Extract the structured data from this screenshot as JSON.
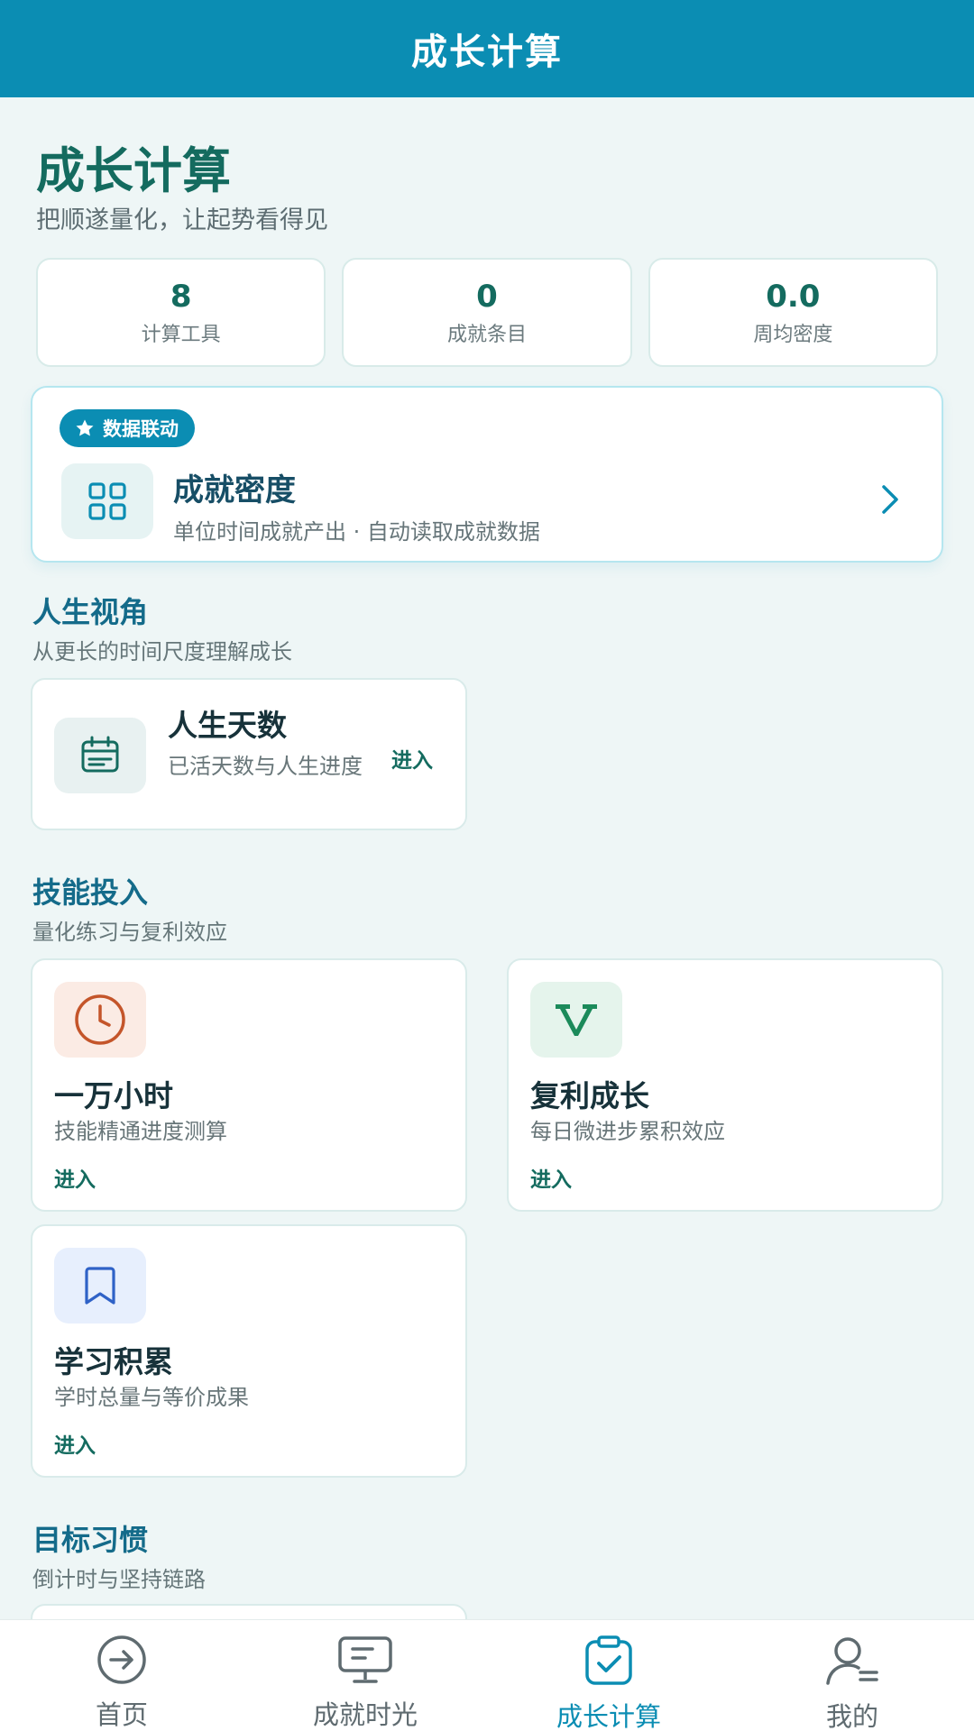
{
  "header": {
    "title": "成长计算"
  },
  "intro": {
    "title": "成长计算",
    "subtitle": "把顺遂量化，让起势看得见"
  },
  "stats": [
    {
      "value": "8",
      "label": "计算工具"
    },
    {
      "value": "0",
      "label": "成就条目"
    },
    {
      "value": "0.0",
      "label": "周均密度"
    }
  ],
  "featured": {
    "badge": "数据联动",
    "title": "成就密度",
    "description": "单位时间成就产出 · 自动读取成就数据",
    "icon": "grid-icon"
  },
  "sections": [
    {
      "title": "人生视角",
      "subtitle": "从更长的时间尺度理解成长",
      "cards": [
        {
          "title": "人生天数",
          "description": "已活天数与人生进度",
          "enter": "进入",
          "icon": "calendar-icon"
        }
      ]
    },
    {
      "title": "技能投入",
      "subtitle": "量化练习与复利效应",
      "cards": [
        {
          "title": "一万小时",
          "description": "技能精通进度测算",
          "enter": "进入",
          "icon": "clock-icon"
        },
        {
          "title": "复利成长",
          "description": "每日微进步累积效应",
          "enter": "进入",
          "icon": "v-letter-icon"
        },
        {
          "title": "学习积累",
          "description": "学时总量与等价成果",
          "enter": "进入",
          "icon": "bookmark-icon"
        }
      ]
    },
    {
      "title": "目标习惯",
      "subtitle": "倒计时与坚持链路"
    }
  ],
  "bottom_nav": [
    {
      "label": "首页",
      "icon": "arrow-circle-icon"
    },
    {
      "label": "成就时光",
      "icon": "monitor-icon"
    },
    {
      "label": "成长计算",
      "icon": "clipboard-check-icon",
      "active": true
    },
    {
      "label": "我的",
      "icon": "user-icon"
    }
  ],
  "colors": {
    "header": "#0b8db3",
    "accent": "#146b5f",
    "background": "#eef6f6"
  }
}
